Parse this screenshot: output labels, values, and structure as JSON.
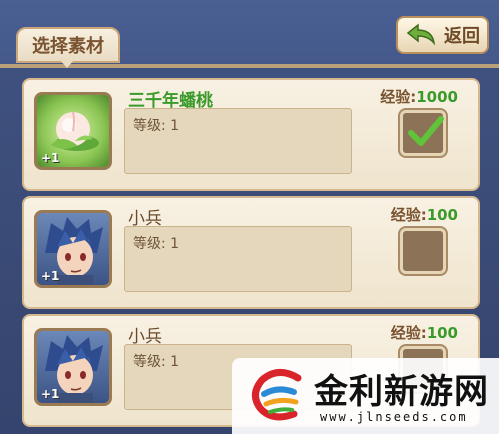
{
  "header": {
    "title": "选择素材",
    "back_label": "返回"
  },
  "items": [
    {
      "name": "三千年蟠桃",
      "exp_label": "经验:",
      "exp_value": "1000",
      "level": "等级: 1",
      "plus": "+1",
      "checked": true,
      "icon": "peach-icon"
    },
    {
      "name": "小兵",
      "exp_label": "经验:",
      "exp_value": "100",
      "level": "等级: 1",
      "plus": "+1",
      "checked": false,
      "icon": "soldier-portrait"
    },
    {
      "name": "小兵",
      "exp_label": "经验:",
      "exp_value": "100",
      "level": "等级: 1",
      "plus": "+1",
      "checked": false,
      "icon": "soldier-portrait"
    }
  ],
  "watermark": {
    "name": "金利新游网",
    "url": "www.jlnseeds.com"
  },
  "colors": {
    "background": "#3f517f",
    "card": "#f8f1e3",
    "exp_green": "#3a9a2a",
    "check_green": "#5fc43a"
  }
}
